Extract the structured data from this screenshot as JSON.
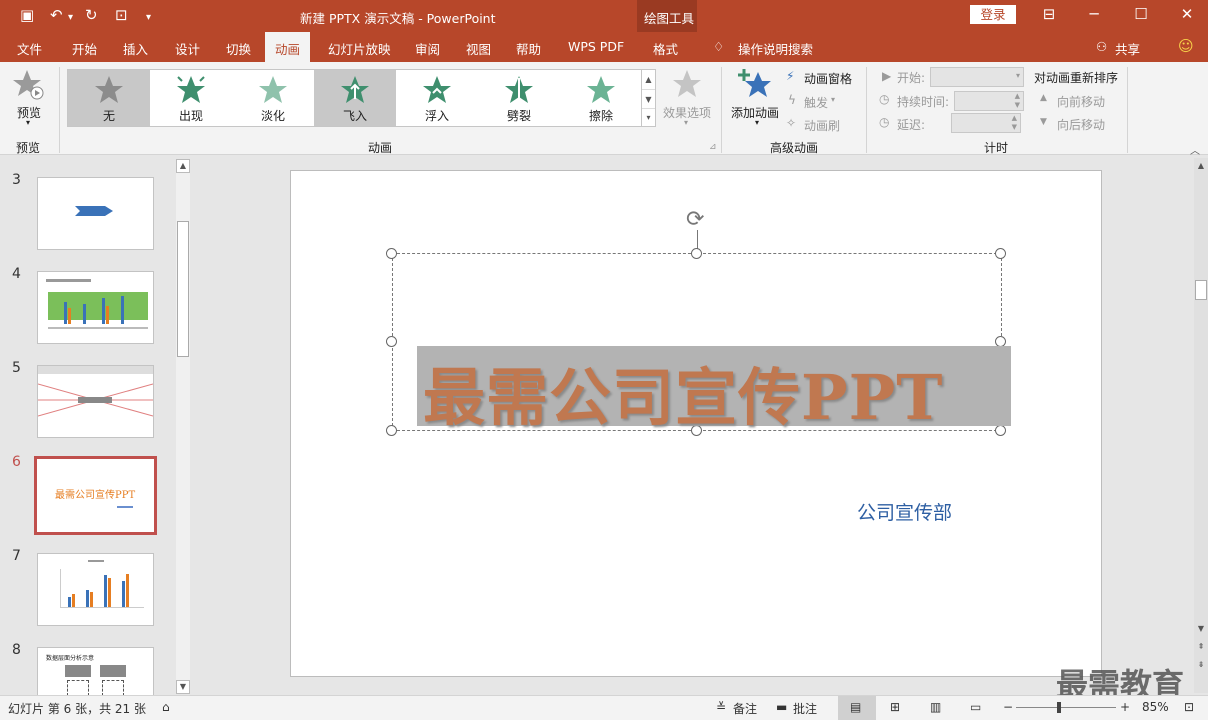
{
  "window": {
    "title": "新建 PPTX 演示文稿  -  PowerPoint",
    "context_tab_group": "绘图工具",
    "login": "登录"
  },
  "tabs": [
    "文件",
    "开始",
    "插入",
    "设计",
    "切换",
    "动画",
    "幻灯片放映",
    "审阅",
    "视图",
    "帮助",
    "WPS PDF",
    "格式"
  ],
  "tab_active": "动画",
  "tell_me": "操作说明搜索",
  "share": "共享",
  "ribbon": {
    "preview": {
      "label": "预览",
      "group": "预览"
    },
    "animation_gallery": {
      "items": [
        "无",
        "出现",
        "淡化",
        "飞入",
        "浮入",
        "劈裂",
        "擦除"
      ],
      "selected": [
        "无",
        "飞入"
      ],
      "effect_options": "效果选项",
      "group": "动画"
    },
    "advanced": {
      "add_animation": "添加动画",
      "animation_pane": "动画窗格",
      "trigger": "触发",
      "painter": "动画刷",
      "group": "高级动画"
    },
    "timing": {
      "start": "开始:",
      "duration": "持续时间:",
      "delay": "延迟:",
      "reorder": "对动画重新排序",
      "move_earlier": "向前移动",
      "move_later": "向后移动",
      "group": "计时"
    }
  },
  "slides_panel": {
    "numbers": [
      "3",
      "4",
      "5",
      "6",
      "7",
      "8"
    ],
    "selected": "6",
    "thumb6_title": "最需公司宣传PPT",
    "thumb8_title": "数据层面分析示意"
  },
  "slide": {
    "title": "最需公司宣传PPT",
    "subtitle": "公司宣传部"
  },
  "status": {
    "slide_info": "幻灯片 第 6 张，共 21 张",
    "notes": "备注",
    "comments": "批注",
    "zoom": "85%"
  },
  "watermark": "最需教育",
  "colors": {
    "accent": "#b7472a",
    "title_text": "#c07850",
    "subtitle_text": "#2e5fa3",
    "selected_thumb_border": "#c0504d"
  }
}
